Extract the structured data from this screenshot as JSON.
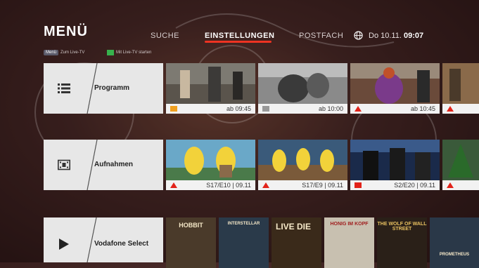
{
  "header": {
    "title": "MENÜ",
    "nav": [
      {
        "label": "SUCHE"
      },
      {
        "label": "EINSTELLUNGEN"
      },
      {
        "label": "POSTFACH"
      }
    ],
    "clock_day": "Do 10.11.",
    "clock_time": "09:07",
    "hint_chip": "Menü",
    "hint_text": "Zum Live-TV",
    "hint_green": "Mit Live-TV starten"
  },
  "rows": [
    {
      "label": "Programm",
      "icon": "list-icon",
      "items": [
        {
          "caption": "ab 09:45"
        },
        {
          "caption": "ab 10:00"
        },
        {
          "caption": "ab 10:45"
        }
      ]
    },
    {
      "label": "Aufnahmen",
      "icon": "film-icon",
      "items": [
        {
          "caption": "S17/E10 | 09.11"
        },
        {
          "caption": "S17/E9 | 09.11"
        },
        {
          "caption": "S2/E20 | 09.11"
        }
      ]
    },
    {
      "label": "Vodafone Select",
      "icon": "play-icon",
      "posters": [
        {
          "title": "HOBBIT"
        },
        {
          "title": "INTERSTELLAR"
        },
        {
          "title": "LIVE DIE"
        },
        {
          "title": "HONIG IM KOPF"
        },
        {
          "title": "THE WOLF OF WALL STREET"
        },
        {
          "title": "PROMETHEUS"
        }
      ]
    }
  ],
  "colors": {
    "accent": "#e53322",
    "green_key": "#37b24d",
    "channel_red": "#e2231a"
  }
}
